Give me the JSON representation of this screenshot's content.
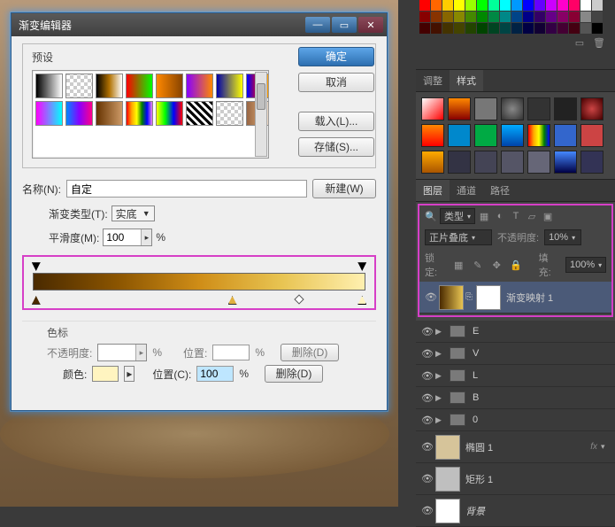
{
  "dialog": {
    "title": "渐变编辑器",
    "presets_label": "预设",
    "buttons": {
      "ok": "确定",
      "cancel": "取消",
      "load": "载入(L)...",
      "save": "存储(S)..."
    },
    "name_label": "名称(N):",
    "name_value": "自定",
    "new_btn": "新建(W)",
    "type_label": "渐变类型(T):",
    "type_value": "实底",
    "smooth_label": "平滑度(M):",
    "smooth_value": "100",
    "percent": "%",
    "stops_title": "色标",
    "opacity_label": "不透明度:",
    "position_label": "位置:",
    "position_c_label": "位置(C):",
    "position_value": "100",
    "color_label": "颜色:",
    "delete_btn": "删除(D)"
  },
  "right": {
    "adjust_tab": "调整",
    "styles_tab": "样式",
    "layers_tab": "图层",
    "channels_tab": "通道",
    "paths_tab": "路径",
    "kind_label": "类型",
    "mag_label": "正片叠底",
    "opacity_label": "不透明度:",
    "opacity_value": "10%",
    "lock_label": "锁定:",
    "fill_label": "填充:",
    "fill_value": "100%",
    "highlight_label": "渐变映射 1",
    "layers": [
      {
        "kind": "grad",
        "name": "渐变映射 1"
      },
      {
        "kind": "grp",
        "name": "E"
      },
      {
        "kind": "grp",
        "name": "V"
      },
      {
        "kind": "grp",
        "name": "L"
      },
      {
        "kind": "grp",
        "name": "B"
      },
      {
        "kind": "grp",
        "name": "0"
      },
      {
        "kind": "shape",
        "name": "椭圆 1",
        "fx": true,
        "thumb": "#d6c49a"
      },
      {
        "kind": "shape",
        "name": "矩形 1",
        "thumb": "#bfbfbf"
      },
      {
        "kind": "bg",
        "name": "背景",
        "thumb": "#ffffff"
      }
    ],
    "fx_text": "fx"
  }
}
